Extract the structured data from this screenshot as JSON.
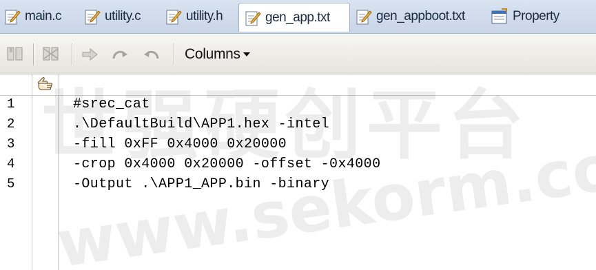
{
  "tabs": [
    {
      "label": "main.c",
      "icon": "file-edit-icon"
    },
    {
      "label": "utility.c",
      "icon": "file-edit-icon"
    },
    {
      "label": "utility.h",
      "icon": "file-edit-icon"
    },
    {
      "label": "gen_app.txt",
      "icon": "file-edit-icon",
      "active": true
    },
    {
      "label": "gen_appboot.txt",
      "icon": "file-edit-icon"
    },
    {
      "label": "Property",
      "icon": "property-icon"
    }
  ],
  "toolbar": {
    "columns_label": "Columns",
    "buttons": [
      "toggle-bookmark-icon",
      "clear-bookmarks-icon",
      "go-to-icon",
      "redo-icon",
      "undo-icon"
    ]
  },
  "editor": {
    "lines": [
      {
        "num": "1",
        "text": "#srec_cat"
      },
      {
        "num": "2",
        "text": ".\\DefaultBuild\\APP1.hex -intel"
      },
      {
        "num": "3",
        "text": "-fill 0xFF 0x4000 0x20000"
      },
      {
        "num": "4",
        "text": "-crop 0x4000 0x20000 -offset -0x4000"
      },
      {
        "num": "5",
        "text": "-Output .\\APP1_APP.bin -binary"
      }
    ]
  },
  "watermark": {
    "text": "世强硬创平台",
    "url_text": "www.sekorm.com"
  },
  "colors": {
    "tab_bar": "#d9e3f1",
    "toolbar": "#ecebe5",
    "accent": "#2f5fa8"
  }
}
